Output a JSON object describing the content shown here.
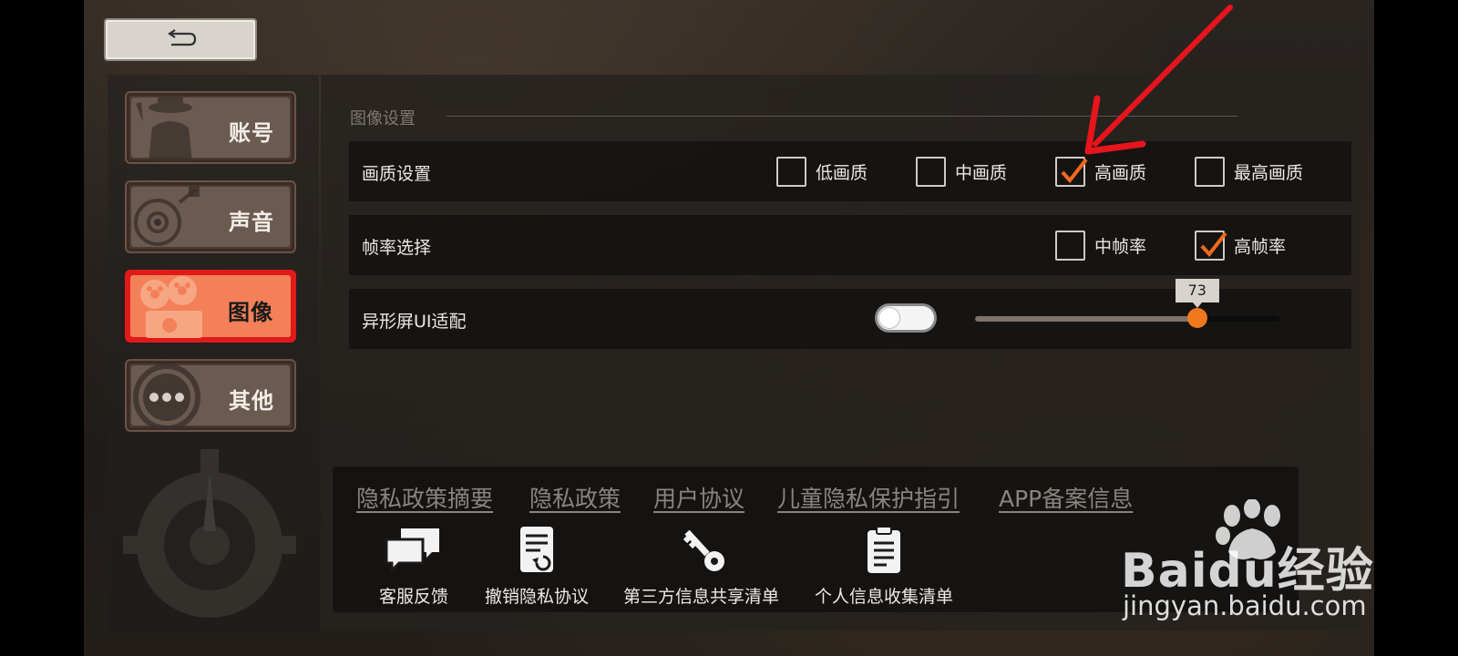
{
  "back_button": {
    "icon": "back-arrow-icon"
  },
  "sidebar": {
    "tabs": [
      {
        "label": "账号",
        "icon": "detective-icon",
        "active": false
      },
      {
        "label": "声音",
        "icon": "record-player-icon",
        "active": false
      },
      {
        "label": "图像",
        "icon": "film-projector-icon",
        "active": true
      },
      {
        "label": "其他",
        "icon": "more-dots-icon",
        "active": false
      }
    ]
  },
  "graphics": {
    "section_title": "图像设置",
    "quality": {
      "label": "画质设置",
      "options": [
        {
          "label": "低画质",
          "checked": false
        },
        {
          "label": "中画质",
          "checked": false
        },
        {
          "label": "高画质",
          "checked": true
        },
        {
          "label": "最高画质",
          "checked": false
        }
      ]
    },
    "framerate": {
      "label": "帧率选择",
      "options": [
        {
          "label": "中帧率",
          "checked": false
        },
        {
          "label": "高帧率",
          "checked": true
        }
      ]
    },
    "notch": {
      "label": "异形屏UI适配",
      "toggle_on": false,
      "slider_value": "73",
      "slider_fraction": 0.73
    }
  },
  "footer": {
    "links": [
      "隐私政策摘要",
      "隐私政策",
      "用户协议",
      "儿童隐私保护指引",
      "APP备案信息"
    ],
    "items": [
      {
        "label": "客服反馈",
        "icon": "chat-bubbles-icon"
      },
      {
        "label": "撤销隐私协议",
        "icon": "revoke-document-icon"
      },
      {
        "label": "第三方信息共享清单",
        "icon": "key-icon"
      },
      {
        "label": "个人信息收集清单",
        "icon": "clipboard-icon"
      }
    ]
  },
  "watermark": {
    "brand": "Baidu经验",
    "url": "jingyan.baidu.com"
  },
  "colors": {
    "accent": "#f0781e",
    "active_tab": "#f38059",
    "highlight_border": "#e01a1a",
    "annotation_arrow": "#e8141c"
  }
}
